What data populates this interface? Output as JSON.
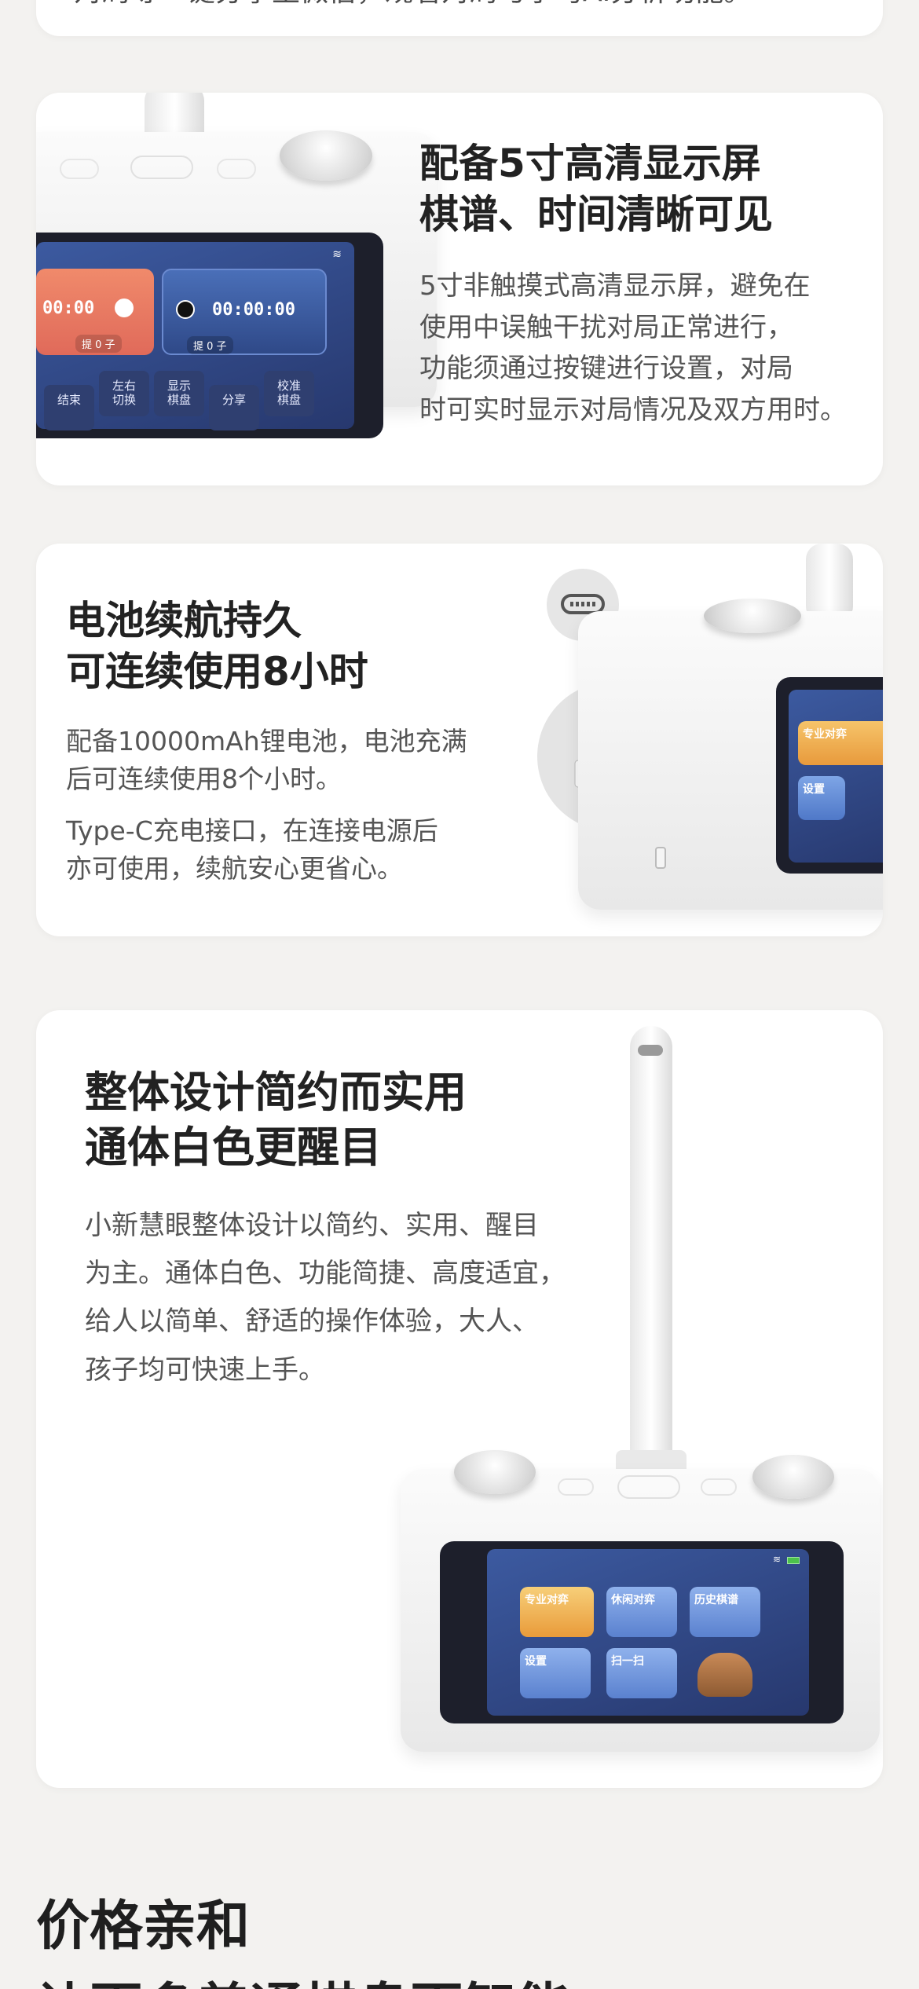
{
  "top": {
    "cut_text": "对局等一键分享至微信，观看对局与学习AI分析功能。"
  },
  "card1": {
    "title_line1": "配备5寸高清显示屏",
    "title_line2": "棋谱、时间清晰可见",
    "desc": [
      "5寸非触摸式高清显示屏，避免在",
      "使用中误触干扰对局正常进行，",
      "功能须通过按键进行设置，对局",
      "时可实时显示对局情况及双方用时。"
    ],
    "screen": {
      "timer_left": "00:00",
      "timer_right": "00:00:00",
      "capture_left": "提 0 子",
      "capture_right": "提 0 子",
      "buttons": [
        "结束",
        "左右\n切换",
        "显示\n棋盘",
        "分享",
        "校准\n棋盘"
      ]
    }
  },
  "card2": {
    "title_line1": "电池续航持久",
    "title_line2": "可连续使用8小时",
    "desc1": [
      "配备10000mAh锂电池，电池充满",
      "后可连续使用8个小时。"
    ],
    "desc2": [
      "Type-C充电接口，在连接电源后",
      "亦可使用，续航安心更省心。"
    ],
    "screen_tiles": [
      "专业对弈",
      "设置"
    ]
  },
  "card3": {
    "title_line1": "整体设计简约而实用",
    "title_line2": "通体白色更醒目",
    "desc": [
      "小新慧眼整体设计以简约、实用、醒目",
      "为主。通体白色、功能简捷、高度适宜，",
      "给人以简单、舒适的操作体验，大人、",
      "孩子均可快速上手。"
    ],
    "screen_tiles": [
      "专业对弈",
      "休闲对弈",
      "历史棋谱",
      "设置",
      "扫一扫"
    ]
  },
  "bottom": {
    "title_line1": "价格亲和",
    "title_line2": "让更多普通棋盘更智能"
  },
  "colors": {
    "background": "#f3f2f0",
    "card": "#ffffff",
    "accent_orange": "#f0a640",
    "screen_blue": "#3c5aa0"
  }
}
